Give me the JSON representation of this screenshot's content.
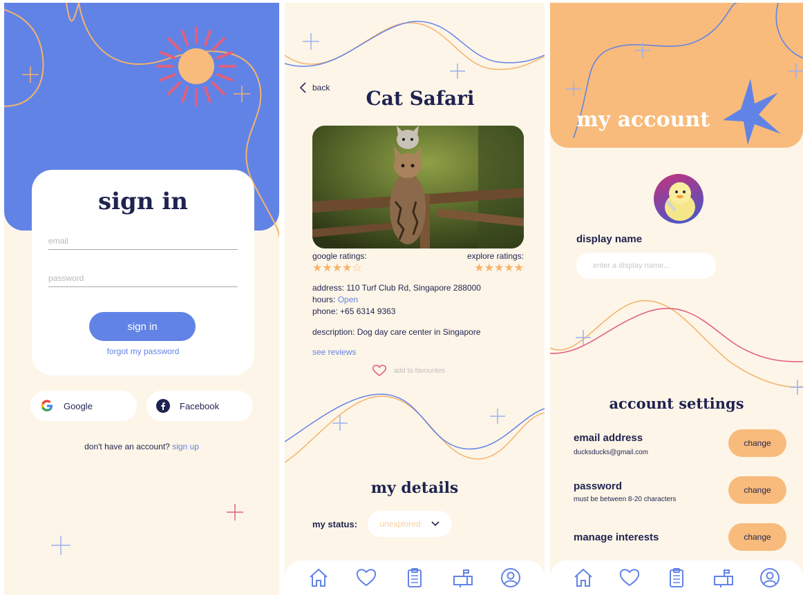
{
  "signin_screen": {
    "title": "sign in",
    "email_placeholder": "email",
    "password_placeholder": "password",
    "signin_button": "sign in",
    "forgot_link": "forgot my password",
    "google_label": "Google",
    "facebook_label": "Facebook",
    "no_account_text": "don't have an account?",
    "signup_link": "sign up"
  },
  "place_screen": {
    "back_label": "back",
    "title": "Cat Safari",
    "google_ratings_label": "google ratings:",
    "google_rating": 4,
    "explore_ratings_label": "explore ratings:",
    "explore_rating": 5,
    "address_label": "address:",
    "address": "110 Turf Club Rd, Singapore 288000",
    "hours_label": "hours:",
    "hours": "Open",
    "phone_label": "phone:",
    "phone": "+65 6314 9363",
    "description_label": "description:",
    "description": "Dog day care center in Singapore",
    "see_reviews": "see reviews",
    "add_favourites": "add to favourites",
    "details_heading": "my details",
    "status_label": "my status:",
    "status_value": "unexplored"
  },
  "account_screen": {
    "title": "my account",
    "display_name_label": "display name",
    "display_name_placeholder": "enter a display name...",
    "settings_heading": "account settings",
    "settings": [
      {
        "title": "email address",
        "subtitle": "ducksducks@gmail.com",
        "button": "change"
      },
      {
        "title": "password",
        "subtitle": "must be between 8-20 characters",
        "button": "change"
      },
      {
        "title": "manage interests",
        "subtitle": "",
        "button": "change"
      }
    ]
  },
  "navbar": [
    "home-icon",
    "heart-icon",
    "clipboard-icon",
    "mailbox-icon",
    "profile-icon"
  ],
  "colors": {
    "blue": "#6283e6",
    "cream": "#fdf5e8",
    "orange": "#f8bb7b",
    "navy": "#1f2350",
    "sun_rays": "#e0607e"
  }
}
